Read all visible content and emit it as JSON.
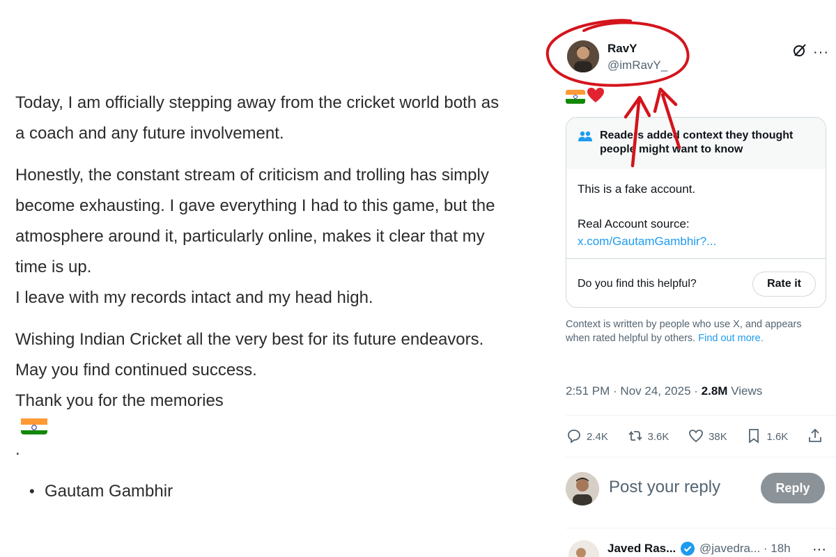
{
  "statement": {
    "paragraphs": [
      [
        "Today, I am officially stepping away from the cricket world both as",
        "a coach and any future involvement."
      ],
      [
        "Honestly, the constant stream of criticism and trolling has simply",
        "become exhausting. I gave everything I had to this game, but the",
        "atmosphere around it, particularly online, makes it clear that my",
        "time is up.",
        "I leave with my records intact and my head high."
      ],
      [
        "Wishing Indian Cricket all the very best for its future endeavors.",
        "May you find continued success.",
        "Thank you for the memories"
      ]
    ],
    "signature": "Gautam Gambhir"
  },
  "author": {
    "display_name": "RavY",
    "handle": "@imRavY_"
  },
  "tweet_emoji": [
    "india-flag",
    "red-heart"
  ],
  "community_note": {
    "title": "Readers added context they thought people might want to know",
    "body_line1": "This is a fake account.",
    "body_line2": "Real Account source:",
    "link_text": "x.com/GautamGambhir?...",
    "question": "Do you find this helpful?",
    "rate_label": "Rate it"
  },
  "disclaimer": {
    "text": "Context is written by people who use X, and appears when rated helpful by others.",
    "link_text": "Find out more."
  },
  "meta": {
    "time": "2:51 PM",
    "date": "Nov 24, 2025",
    "views_count": "2.8M",
    "views_label": "Views"
  },
  "actions": {
    "replies": "2.4K",
    "reposts": "3.6K",
    "likes": "38K",
    "bookmarks": "1.6K"
  },
  "reply_box": {
    "placeholder": "Post your reply",
    "button_label": "Reply"
  },
  "next_reply": {
    "name": "Javed Ras...",
    "handle": "@javedra...",
    "time": "18h"
  },
  "colors": {
    "link_blue": "#1d9bf0",
    "annotation_red": "#d4141c",
    "muted_text": "#536471"
  },
  "icons": [
    "people-icon",
    "grok-icon",
    "more-icon",
    "reply-icon",
    "repost-icon",
    "like-icon",
    "bookmark-icon",
    "share-icon",
    "verified-icon"
  ]
}
